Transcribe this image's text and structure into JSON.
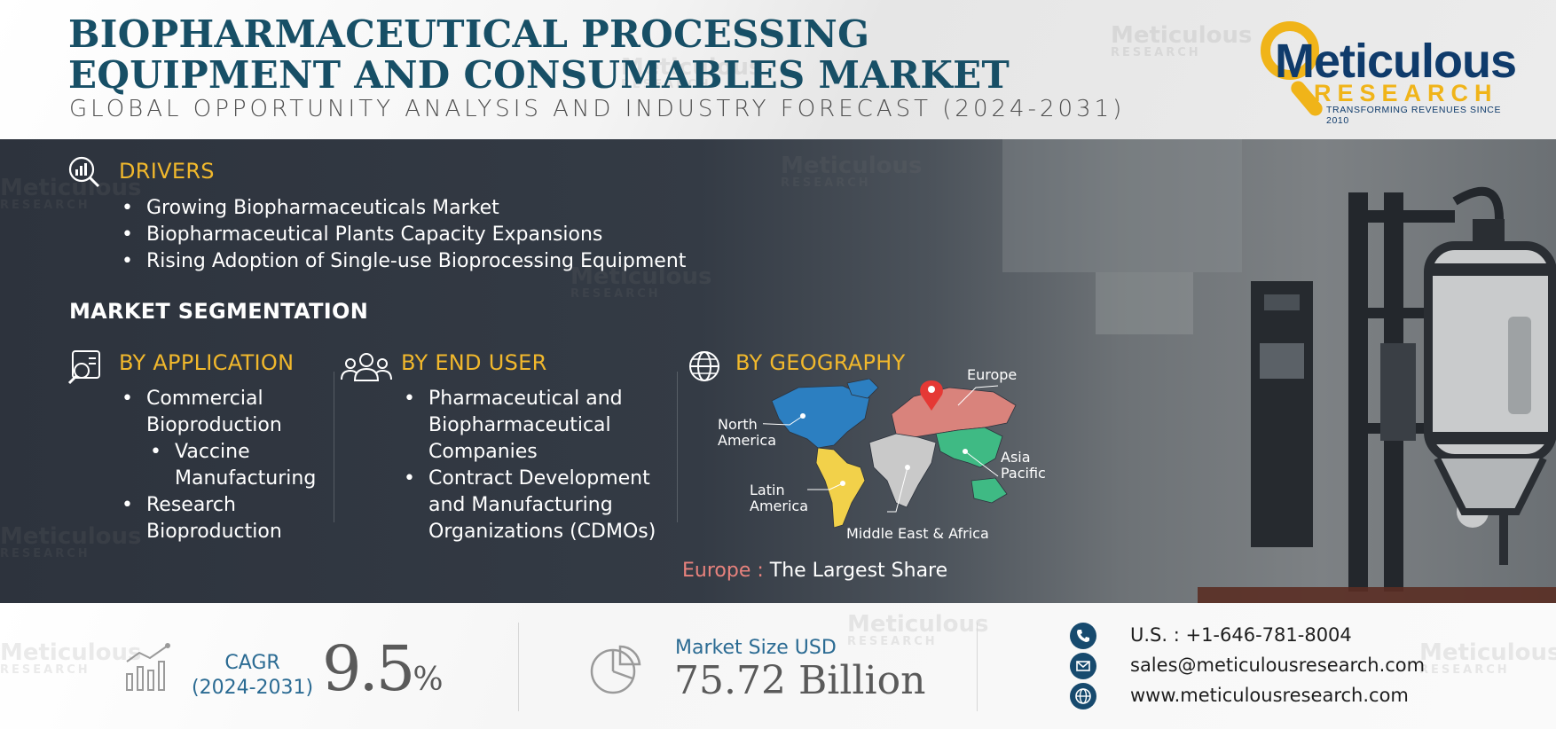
{
  "header": {
    "title": "BIOPHARMACEUTICAL PROCESSING EQUIPMENT AND CONSUMABLES MARKET",
    "subtitle": "GLOBAL OPPORTUNITY ANALYSIS AND INDUSTRY FORECAST (2024-2031)",
    "logo": {
      "word": "Meticulous",
      "research": "RESEARCH",
      "tagline": "TRANSFORMING REVENUES SINCE 2010"
    }
  },
  "watermark": {
    "word": "Meticulous",
    "sub": "RESEARCH"
  },
  "drivers": {
    "heading": "DRIVERS",
    "items": [
      "Growing Biopharmaceuticals Market",
      "Biopharmaceutical Plants Capacity Expansions",
      "Rising Adoption of Single-use Bioprocessing Equipment"
    ]
  },
  "segmentation": {
    "heading": "MARKET SEGMENTATION",
    "application": {
      "heading": "BY APPLICATION",
      "items": [
        "Commercial Bioproduction",
        "Vaccine Manufacturing",
        "Research Bioproduction"
      ]
    },
    "end_user": {
      "heading": "BY END USER",
      "items": [
        "Pharmaceutical and Biopharmaceutical Companies",
        "Contract Development and Manufacturing Organizations (CDMOs)"
      ]
    },
    "geography": {
      "heading": "BY GEOGRAPHY",
      "regions": {
        "europe": "Europe",
        "north_america": "North America",
        "asia_pacific": "Asia Pacific",
        "latin_america": "Latin America",
        "mea": "Middle East & Africa"
      },
      "colors": {
        "north_america": "#2c7fc1",
        "latin_america": "#f2d14a",
        "europe": "#d9837c",
        "mea": "#c9c9c9",
        "asia_pacific": "#3fba84"
      },
      "largest_share_region": "Europe :",
      "largest_share_text": " The Largest Share"
    }
  },
  "stats": {
    "cagr_label": "CAGR",
    "cagr_period": "(2024-2031)",
    "cagr_value": "9.5",
    "cagr_unit": "%",
    "market_size_label": "Market Size USD",
    "market_size_value": "75.72 Billion"
  },
  "contact": {
    "phone": "U.S. : +1-646-781-8004",
    "email": "sales@meticulousresearch.com",
    "website": "www.meticulousresearch.com"
  }
}
